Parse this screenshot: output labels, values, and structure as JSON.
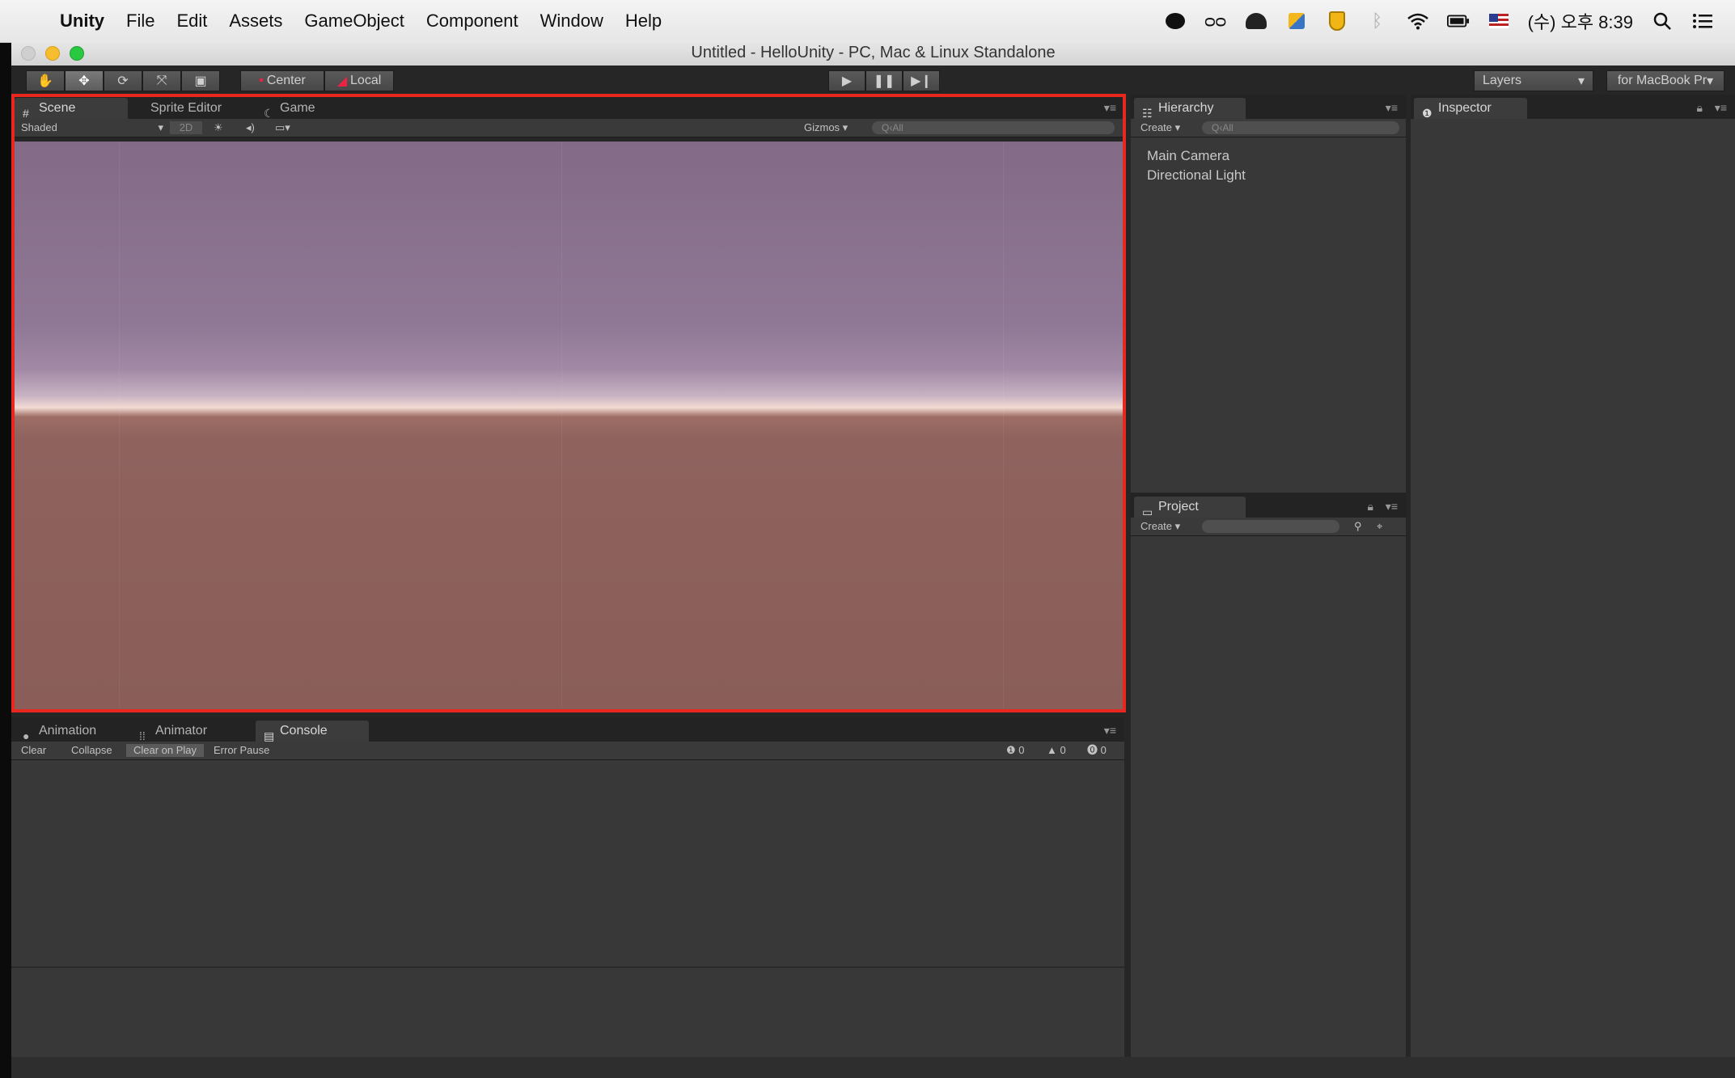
{
  "menubar": {
    "app": "Unity",
    "items": [
      "File",
      "Edit",
      "Assets",
      "GameObject",
      "Component",
      "Window",
      "Help"
    ],
    "clock": "(수) 오후 8:39"
  },
  "window": {
    "title": "Untitled - HelloUnity - PC, Mac & Linux Standalone"
  },
  "toolbar": {
    "pivot": "Center",
    "space": "Local",
    "layers": "Layers",
    "layout": "for MacBook Pr"
  },
  "scene": {
    "tabs": [
      "Scene",
      "Sprite Editor",
      "Game"
    ],
    "shading": "Shaded",
    "mode2d": "2D",
    "gizmos": "Gizmos",
    "search_placeholder": "Q‹All"
  },
  "console": {
    "tabs": [
      "Animation",
      "Animator",
      "Console"
    ],
    "buttons": [
      "Clear",
      "Collapse",
      "Clear on Play",
      "Error Pause"
    ],
    "counts": [
      "0",
      "0",
      "0"
    ]
  },
  "hierarchy": {
    "title": "Hierarchy",
    "create": "Create",
    "search_placeholder": "Q‹All",
    "items": [
      "Main Camera",
      "Directional Light"
    ]
  },
  "project": {
    "title": "Project",
    "create": "Create"
  },
  "inspector": {
    "title": "Inspector"
  }
}
